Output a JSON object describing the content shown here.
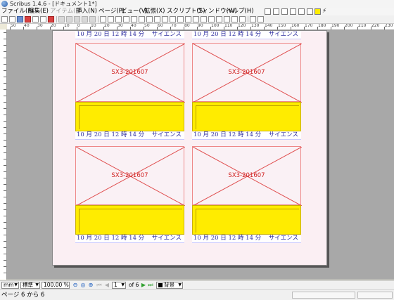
{
  "window": {
    "title": "Scribus 1.4.6 - [ドキュメント1*]"
  },
  "menu": {
    "file": "ファイル(F)",
    "edit": "編集(E)",
    "item": "アイテム(I)",
    "insert": "挿入(N)",
    "page": "ページ(P)",
    "view": "ビュー(V)",
    "extras": "拡張(X)",
    "script": "スクリプト(S)",
    "windows": "ウィンドウ(W)",
    "help": "ヘルプ(H)"
  },
  "ruler": {
    "labels": [
      "50",
      "40",
      "30",
      "20",
      "10",
      "0",
      "10",
      "20",
      "30",
      "40",
      "50",
      "60",
      "70",
      "80",
      "90",
      "100",
      "110",
      "120",
      "130",
      "140",
      "150",
      "160",
      "170",
      "180",
      "190",
      "200",
      "210",
      "220",
      "230",
      "240"
    ]
  },
  "cards": [
    {
      "date": "10 月 20 日 12 時 14 分",
      "category": "サイエンス"
    },
    {
      "date": "10 月 20 日 12 時 14 分",
      "category": "サイエンス"
    },
    {
      "date": "10 月 20 日 12 時 14 分",
      "category": "サイエンス",
      "image_label": "SX3-201607"
    },
    {
      "date": "10 月 20 日 12 時 14 分",
      "category": "サイエンス",
      "image_label": "SX3-201607"
    },
    {
      "date": "10 月 20 日 12 時 14 分",
      "category": "サイエンス",
      "image_label": "SX3-201607"
    },
    {
      "date": "10 月 20 日 12 時 14 分",
      "category": "サイエンス",
      "image_label": "SX3-201607"
    }
  ],
  "statusbar": {
    "unit": "mm",
    "mode": "標準",
    "zoom": "100.00 %",
    "page_number": "1",
    "page_of": "of 6",
    "layer": "背景"
  },
  "footer": {
    "status": "ページ 6 から 6"
  },
  "colors": {
    "frame_yellow": "#ffec00",
    "caption_blue": "#3030a0",
    "image_red": "#d02020",
    "page_pink": "#fbeff3"
  }
}
